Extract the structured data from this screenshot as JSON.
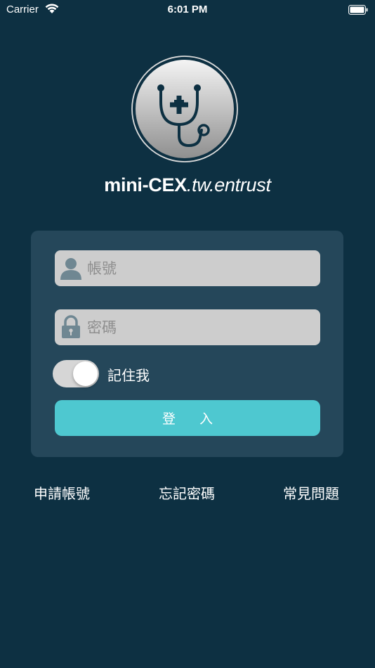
{
  "status_bar": {
    "carrier": "Carrier",
    "time": "6:01 PM"
  },
  "app": {
    "brand": "mini-CEX",
    "suffix": ".tw.entrust"
  },
  "login_form": {
    "account_placeholder": "帳號",
    "password_placeholder": "密碼",
    "account_icon": "user-icon",
    "password_icon": "lock-icon",
    "remember_label": "記住我",
    "remember_on": true,
    "login_label": "登入"
  },
  "links": {
    "apply": "申請帳號",
    "forgot": "忘記密碼",
    "faq": "常見問題"
  },
  "colors": {
    "background": "#0d3042",
    "card": "#25475a",
    "accent": "#4ec8d0",
    "field": "#cdcdcd"
  }
}
